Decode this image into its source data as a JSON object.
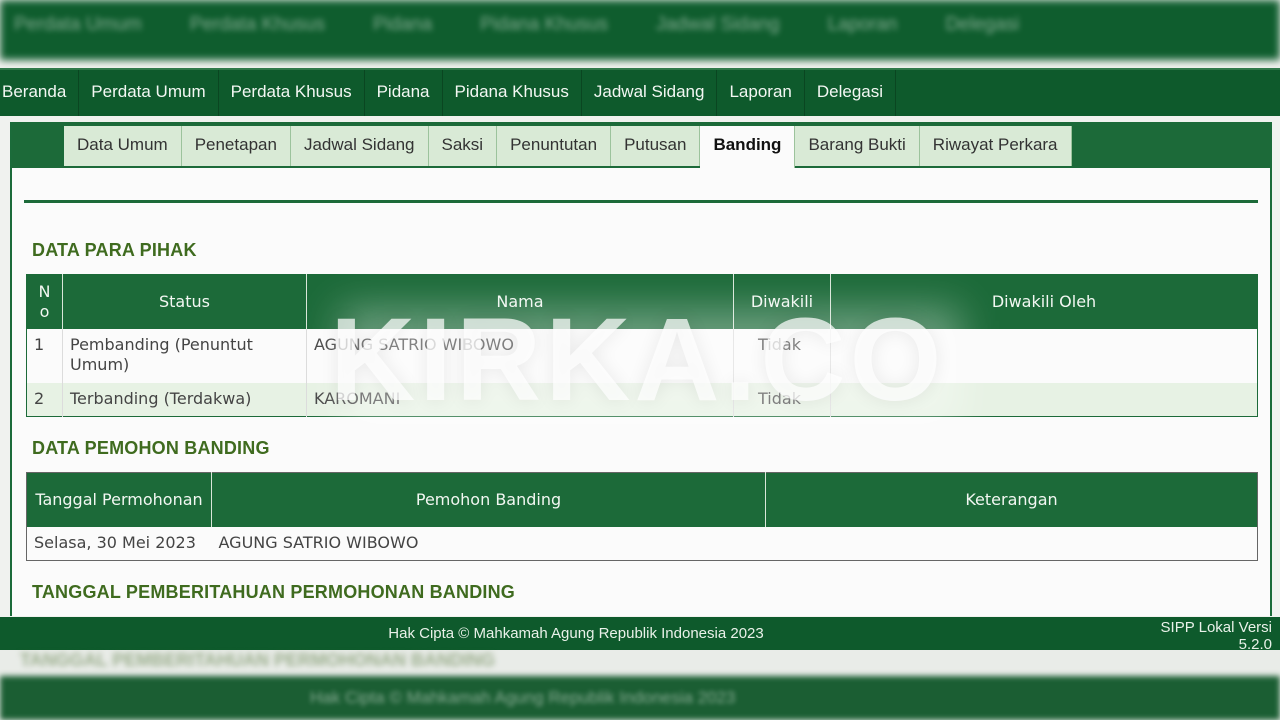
{
  "nav": {
    "items": [
      "Beranda",
      "Perdata Umum",
      "Perdata Khusus",
      "Pidana",
      "Pidana Khusus",
      "Jadwal Sidang",
      "Laporan",
      "Delegasi"
    ]
  },
  "tabs": {
    "items": [
      "Data Umum",
      "Penetapan",
      "Jadwal Sidang",
      "Saksi",
      "Penuntutan",
      "Putusan",
      "Banding",
      "Barang Bukti",
      "Riwayat Perkara"
    ],
    "active": "Banding"
  },
  "sections": {
    "para_pihak": "DATA PARA PIHAK",
    "pemohon_banding": "DATA PEMOHON BANDING",
    "pemberitahuan": "TANGGAL PEMBERITAHUAN PERMOHONAN BANDING"
  },
  "para_pihak_table": {
    "headers": [
      "No",
      "Status",
      "Nama",
      "Diwakili",
      "Diwakili Oleh"
    ],
    "rows": [
      {
        "no": "1",
        "status": "Pembanding (Penuntut Umum)",
        "nama": "AGUNG SATRIO WIBOWO",
        "diwakili": "Tidak",
        "diwakili_oleh": ""
      },
      {
        "no": "2",
        "status": "Terbanding (Terdakwa)",
        "nama": "KAROMANI",
        "diwakili": "Tidak",
        "diwakili_oleh": ""
      }
    ]
  },
  "pemohon_table": {
    "headers": [
      "Tanggal Permohonan",
      "Pemohon Banding",
      "Keterangan"
    ],
    "rows": [
      {
        "tanggal": "Selasa, 30 Mei 2023",
        "pemohon": "AGUNG SATRIO WIBOWO",
        "keterangan": ""
      }
    ]
  },
  "watermark": "KIRKA.CO",
  "footer": {
    "copyright": "Hak Cipta © Mahkamah Agung Republik Indonesia 2023",
    "version_line1": "SIPP Lokal Versi",
    "version_line2": "5.2.0"
  }
}
